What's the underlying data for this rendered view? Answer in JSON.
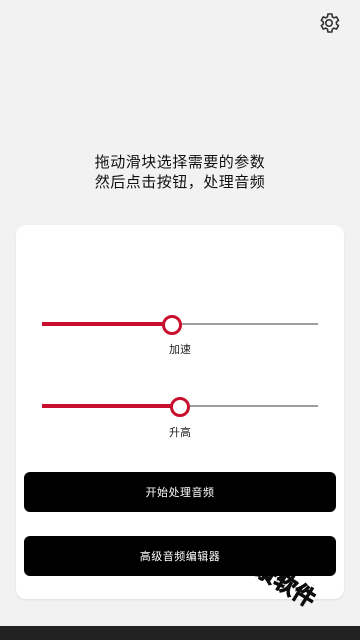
{
  "header": {
    "settings_icon": "gear-icon"
  },
  "instructions": {
    "line1": "拖动滑块选择需要的参数",
    "line2": "然后点击按钮，处理音频"
  },
  "sliders": [
    {
      "label": "加速",
      "value": 0.47
    },
    {
      "label": "升高",
      "value": 0.5
    }
  ],
  "buttons": {
    "process": "开始处理音频",
    "editor": "高级音频编辑器"
  },
  "watermark": "千景软件",
  "colors": {
    "accent": "#c8102e",
    "button_bg": "#000000",
    "card_bg": "#ffffff",
    "page_bg": "#f2f2f2"
  }
}
